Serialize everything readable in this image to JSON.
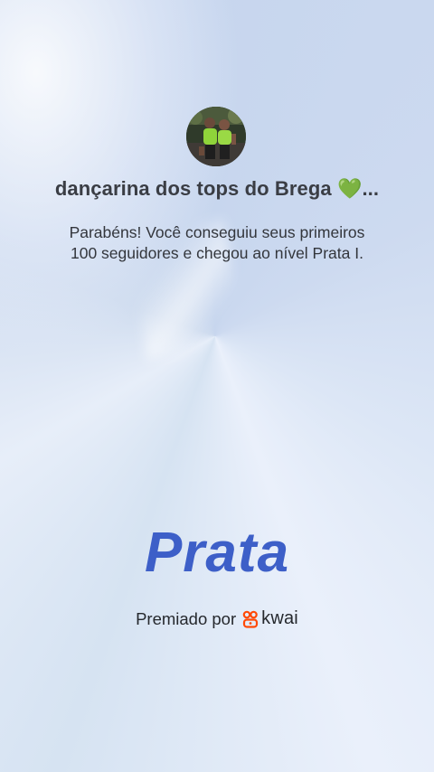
{
  "profile": {
    "name": "dançarina dos tops do Brega 💚...",
    "avatar_alt": "user-avatar"
  },
  "message": {
    "line1": "Parabéns! Você conseguiu seus primeiros",
    "line2": "100 seguidores e chegou ao nível Prata I."
  },
  "level": {
    "label": "Prata"
  },
  "footer": {
    "awarded_by": "Premiado por",
    "brand_name": "kwai",
    "brand_icon": "kwai-logo-icon",
    "brand_color": "#ff4906"
  },
  "colors": {
    "level_text": "#3d5fc8",
    "title_text": "#3a3d44"
  }
}
